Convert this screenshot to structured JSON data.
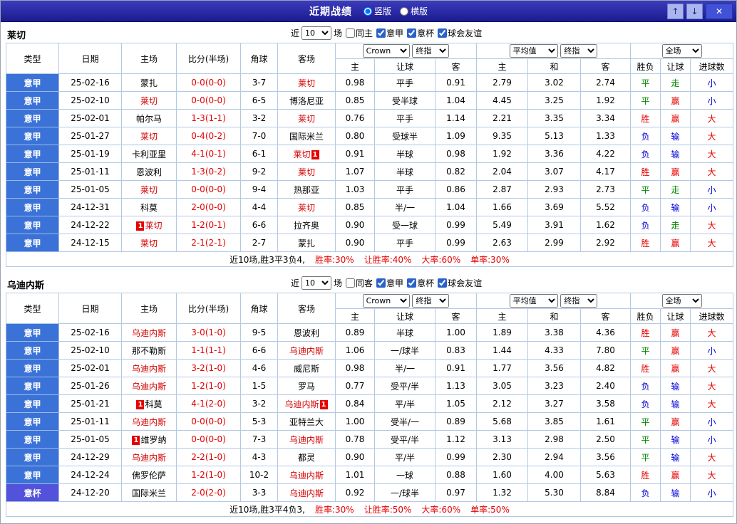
{
  "titlebar": {
    "title": "近期战绩",
    "layout_vertical": "竖版",
    "layout_horizontal": "横版",
    "up_icon": "↑",
    "down_icon": "↓",
    "close_icon": "✕"
  },
  "controls": {
    "near": "近",
    "count": "10",
    "games": "场",
    "bookmaker": "Crown",
    "final_index": "终指",
    "average": "平均值",
    "full_match": "全场"
  },
  "columns": {
    "type": "类型",
    "date": "日期",
    "home": "主场",
    "score": "比分(半场)",
    "corners": "角球",
    "away": "客场",
    "odds_home": "主",
    "odds_handicap": "让球",
    "odds_away": "客",
    "avg_home": "主",
    "avg_draw": "和",
    "avg_away": "客",
    "result_wdl": "胜负",
    "result_handicap": "让球",
    "result_goals": "进球数"
  },
  "result_colors": {
    "win": "#e60000",
    "draw": "#008800",
    "loss": "#0000d8"
  },
  "tables": [
    {
      "team": "莱切",
      "filters": [
        {
          "label": "同主",
          "checked": false
        },
        {
          "label": "意甲",
          "checked": true
        },
        {
          "label": "意杯",
          "checked": true
        },
        {
          "label": "球会友谊",
          "checked": true
        }
      ],
      "rows": [
        {
          "league": "意甲",
          "cup": false,
          "date": "25-02-16",
          "home": "蒙扎",
          "home_card": "",
          "home_focus": false,
          "score": "0-0(0-0)",
          "corners": "3-7",
          "away": "莱切",
          "away_card": "",
          "away_focus": true,
          "odds_home": "0.98",
          "handicap": "平手",
          "odds_away": "0.91",
          "avg_home": "2.79",
          "avg_draw": "3.02",
          "avg_away": "2.74",
          "res_wdl": "平",
          "res_handicap": "走",
          "res_goals": "小"
        },
        {
          "league": "意甲",
          "cup": false,
          "date": "25-02-10",
          "home": "莱切",
          "home_card": "",
          "home_focus": true,
          "score": "0-0(0-0)",
          "corners": "6-5",
          "away": "博洛尼亚",
          "away_card": "",
          "away_focus": false,
          "odds_home": "0.85",
          "handicap": "受半球",
          "odds_away": "1.04",
          "avg_home": "4.45",
          "avg_draw": "3.25",
          "avg_away": "1.92",
          "res_wdl": "平",
          "res_handicap": "赢",
          "res_goals": "小"
        },
        {
          "league": "意甲",
          "cup": false,
          "date": "25-02-01",
          "home": "帕尔马",
          "home_card": "",
          "home_focus": false,
          "score": "1-3(1-1)",
          "corners": "3-2",
          "away": "莱切",
          "away_card": "",
          "away_focus": true,
          "odds_home": "0.76",
          "handicap": "平手",
          "odds_away": "1.14",
          "avg_home": "2.21",
          "avg_draw": "3.35",
          "avg_away": "3.34",
          "res_wdl": "胜",
          "res_handicap": "赢",
          "res_goals": "大"
        },
        {
          "league": "意甲",
          "cup": false,
          "date": "25-01-27",
          "home": "莱切",
          "home_card": "",
          "home_focus": true,
          "score": "0-4(0-2)",
          "corners": "7-0",
          "away": "国际米兰",
          "away_card": "",
          "away_focus": false,
          "odds_home": "0.80",
          "handicap": "受球半",
          "odds_away": "1.09",
          "avg_home": "9.35",
          "avg_draw": "5.13",
          "avg_away": "1.33",
          "res_wdl": "负",
          "res_handicap": "输",
          "res_goals": "大"
        },
        {
          "league": "意甲",
          "cup": false,
          "date": "25-01-19",
          "home": "卡利亚里",
          "home_card": "",
          "home_focus": false,
          "score": "4-1(0-1)",
          "corners": "6-1",
          "away": "莱切",
          "away_card": "1",
          "away_focus": true,
          "odds_home": "0.91",
          "handicap": "半球",
          "odds_away": "0.98",
          "avg_home": "1.92",
          "avg_draw": "3.36",
          "avg_away": "4.22",
          "res_wdl": "负",
          "res_handicap": "输",
          "res_goals": "大"
        },
        {
          "league": "意甲",
          "cup": false,
          "date": "25-01-11",
          "home": "恩波利",
          "home_card": "",
          "home_focus": false,
          "score": "1-3(0-2)",
          "corners": "9-2",
          "away": "莱切",
          "away_card": "",
          "away_focus": true,
          "odds_home": "1.07",
          "handicap": "半球",
          "odds_away": "0.82",
          "avg_home": "2.04",
          "avg_draw": "3.07",
          "avg_away": "4.17",
          "res_wdl": "胜",
          "res_handicap": "赢",
          "res_goals": "大"
        },
        {
          "league": "意甲",
          "cup": false,
          "date": "25-01-05",
          "home": "莱切",
          "home_card": "",
          "home_focus": true,
          "score": "0-0(0-0)",
          "corners": "9-4",
          "away": "热那亚",
          "away_card": "",
          "away_focus": false,
          "odds_home": "1.03",
          "handicap": "平手",
          "odds_away": "0.86",
          "avg_home": "2.87",
          "avg_draw": "2.93",
          "avg_away": "2.73",
          "res_wdl": "平",
          "res_handicap": "走",
          "res_goals": "小"
        },
        {
          "league": "意甲",
          "cup": false,
          "date": "24-12-31",
          "home": "科莫",
          "home_card": "",
          "home_focus": false,
          "score": "2-0(0-0)",
          "corners": "4-4",
          "away": "莱切",
          "away_card": "",
          "away_focus": true,
          "odds_home": "0.85",
          "handicap": "半/一",
          "odds_away": "1.04",
          "avg_home": "1.66",
          "avg_draw": "3.69",
          "avg_away": "5.52",
          "res_wdl": "负",
          "res_handicap": "输",
          "res_goals": "小"
        },
        {
          "league": "意甲",
          "cup": false,
          "date": "24-12-22",
          "home": "莱切",
          "home_card": "1",
          "home_focus": true,
          "score": "1-2(0-1)",
          "corners": "6-6",
          "away": "拉齐奥",
          "away_card": "",
          "away_focus": false,
          "odds_home": "0.90",
          "handicap": "受一球",
          "odds_away": "0.99",
          "avg_home": "5.49",
          "avg_draw": "3.91",
          "avg_away": "1.62",
          "res_wdl": "负",
          "res_handicap": "走",
          "res_goals": "大"
        },
        {
          "league": "意甲",
          "cup": false,
          "date": "24-12-15",
          "home": "莱切",
          "home_card": "",
          "home_focus": true,
          "score": "2-1(2-1)",
          "corners": "2-7",
          "away": "蒙扎",
          "away_card": "",
          "away_focus": false,
          "odds_home": "0.90",
          "handicap": "平手",
          "odds_away": "0.99",
          "avg_home": "2.63",
          "avg_draw": "2.99",
          "avg_away": "2.92",
          "res_wdl": "胜",
          "res_handicap": "赢",
          "res_goals": "大"
        }
      ],
      "summary_prefix": "近10场,胜3平3负4,",
      "stats": [
        "胜率:30%",
        "让胜率:40%",
        "大率:60%",
        "单率:30%"
      ]
    },
    {
      "team": "乌迪内斯",
      "filters": [
        {
          "label": "同客",
          "checked": false
        },
        {
          "label": "意甲",
          "checked": true
        },
        {
          "label": "意杯",
          "checked": true
        },
        {
          "label": "球会友谊",
          "checked": true
        }
      ],
      "rows": [
        {
          "league": "意甲",
          "cup": false,
          "date": "25-02-16",
          "home": "乌迪内斯",
          "home_card": "",
          "home_focus": true,
          "score": "3-0(1-0)",
          "corners": "9-5",
          "away": "恩波利",
          "away_card": "",
          "away_focus": false,
          "odds_home": "0.89",
          "handicap": "半球",
          "odds_away": "1.00",
          "avg_home": "1.89",
          "avg_draw": "3.38",
          "avg_away": "4.36",
          "res_wdl": "胜",
          "res_handicap": "赢",
          "res_goals": "大"
        },
        {
          "league": "意甲",
          "cup": false,
          "date": "25-02-10",
          "home": "那不勒斯",
          "home_card": "",
          "home_focus": false,
          "score": "1-1(1-1)",
          "corners": "6-6",
          "away": "乌迪内斯",
          "away_card": "",
          "away_focus": true,
          "odds_home": "1.06",
          "handicap": "一/球半",
          "odds_away": "0.83",
          "avg_home": "1.44",
          "avg_draw": "4.33",
          "avg_away": "7.80",
          "res_wdl": "平",
          "res_handicap": "赢",
          "res_goals": "小"
        },
        {
          "league": "意甲",
          "cup": false,
          "date": "25-02-01",
          "home": "乌迪内斯",
          "home_card": "",
          "home_focus": true,
          "score": "3-2(1-0)",
          "corners": "4-6",
          "away": "威尼斯",
          "away_card": "",
          "away_focus": false,
          "odds_home": "0.98",
          "handicap": "半/一",
          "odds_away": "0.91",
          "avg_home": "1.77",
          "avg_draw": "3.56",
          "avg_away": "4.82",
          "res_wdl": "胜",
          "res_handicap": "赢",
          "res_goals": "大"
        },
        {
          "league": "意甲",
          "cup": false,
          "date": "25-01-26",
          "home": "乌迪内斯",
          "home_card": "",
          "home_focus": true,
          "score": "1-2(1-0)",
          "corners": "1-5",
          "away": "罗马",
          "away_card": "",
          "away_focus": false,
          "odds_home": "0.77",
          "handicap": "受平/半",
          "odds_away": "1.13",
          "avg_home": "3.05",
          "avg_draw": "3.23",
          "avg_away": "2.40",
          "res_wdl": "负",
          "res_handicap": "输",
          "res_goals": "大"
        },
        {
          "league": "意甲",
          "cup": false,
          "date": "25-01-21",
          "home": "科莫",
          "home_card": "1",
          "home_focus": false,
          "score": "4-1(2-0)",
          "corners": "3-2",
          "away": "乌迪内斯",
          "away_card": "1",
          "away_focus": true,
          "odds_home": "0.84",
          "handicap": "平/半",
          "odds_away": "1.05",
          "avg_home": "2.12",
          "avg_draw": "3.27",
          "avg_away": "3.58",
          "res_wdl": "负",
          "res_handicap": "输",
          "res_goals": "大"
        },
        {
          "league": "意甲",
          "cup": false,
          "date": "25-01-11",
          "home": "乌迪内斯",
          "home_card": "",
          "home_focus": true,
          "score": "0-0(0-0)",
          "corners": "5-3",
          "away": "亚特兰大",
          "away_card": "",
          "away_focus": false,
          "odds_home": "1.00",
          "handicap": "受半/一",
          "odds_away": "0.89",
          "avg_home": "5.68",
          "avg_draw": "3.85",
          "avg_away": "1.61",
          "res_wdl": "平",
          "res_handicap": "赢",
          "res_goals": "小"
        },
        {
          "league": "意甲",
          "cup": false,
          "date": "25-01-05",
          "home": "维罗纳",
          "home_card": "1",
          "home_focus": false,
          "score": "0-0(0-0)",
          "corners": "7-3",
          "away": "乌迪内斯",
          "away_card": "",
          "away_focus": true,
          "odds_home": "0.78",
          "handicap": "受平/半",
          "odds_away": "1.12",
          "avg_home": "3.13",
          "avg_draw": "2.98",
          "avg_away": "2.50",
          "res_wdl": "平",
          "res_handicap": "输",
          "res_goals": "小"
        },
        {
          "league": "意甲",
          "cup": false,
          "date": "24-12-29",
          "home": "乌迪内斯",
          "home_card": "",
          "home_focus": true,
          "score": "2-2(1-0)",
          "corners": "4-3",
          "away": "都灵",
          "away_card": "",
          "away_focus": false,
          "odds_home": "0.90",
          "handicap": "平/半",
          "odds_away": "0.99",
          "avg_home": "2.30",
          "avg_draw": "2.94",
          "avg_away": "3.56",
          "res_wdl": "平",
          "res_handicap": "输",
          "res_goals": "大"
        },
        {
          "league": "意甲",
          "cup": false,
          "date": "24-12-24",
          "home": "佛罗伦萨",
          "home_card": "",
          "home_focus": false,
          "score": "1-2(1-0)",
          "corners": "10-2",
          "away": "乌迪内斯",
          "away_card": "",
          "away_focus": true,
          "odds_home": "1.01",
          "handicap": "一球",
          "odds_away": "0.88",
          "avg_home": "1.60",
          "avg_draw": "4.00",
          "avg_away": "5.63",
          "res_wdl": "胜",
          "res_handicap": "赢",
          "res_goals": "大"
        },
        {
          "league": "意杯",
          "cup": true,
          "date": "24-12-20",
          "home": "国际米兰",
          "home_card": "",
          "home_focus": false,
          "score": "2-0(2-0)",
          "corners": "3-3",
          "away": "乌迪内斯",
          "away_card": "",
          "away_focus": true,
          "odds_home": "0.92",
          "handicap": "一/球半",
          "odds_away": "0.97",
          "avg_home": "1.32",
          "avg_draw": "5.30",
          "avg_away": "8.84",
          "res_wdl": "负",
          "res_handicap": "输",
          "res_goals": "小"
        }
      ],
      "summary_prefix": "近10场,胜3平4负3,",
      "stats": [
        "胜率:30%",
        "让胜率:50%",
        "大率:60%",
        "单率:50%"
      ]
    }
  ]
}
